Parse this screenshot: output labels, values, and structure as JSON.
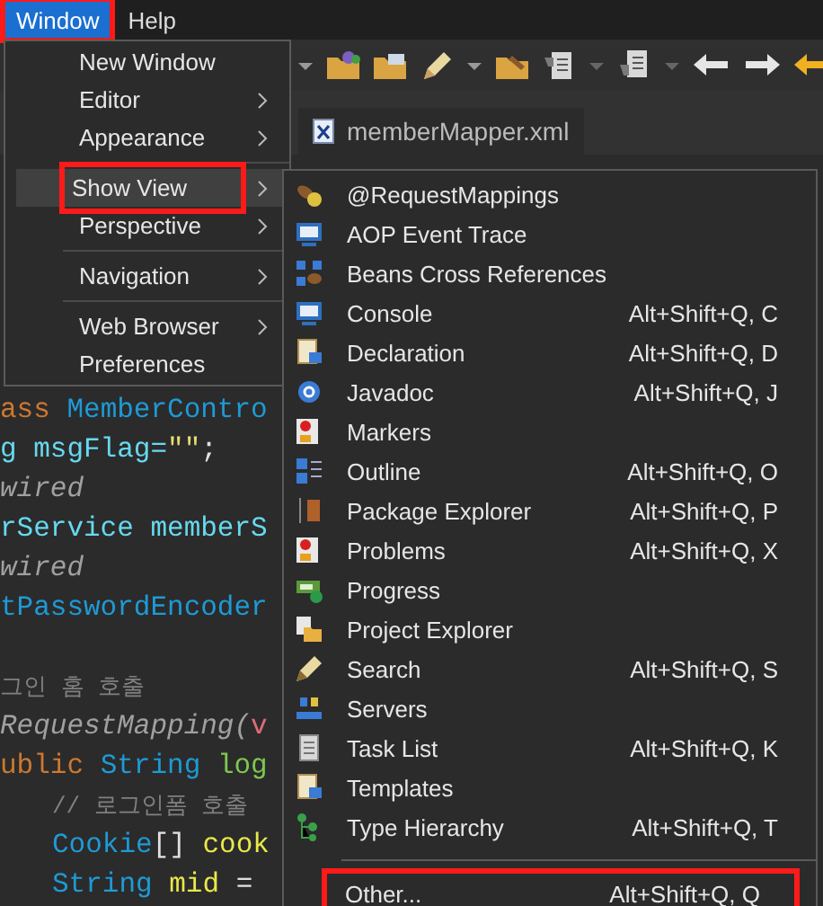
{
  "menubar": [
    {
      "label": "Window",
      "selected": true,
      "annotated": true
    },
    {
      "label": "Help",
      "selected": false,
      "annotated": false
    }
  ],
  "editor_tab": {
    "label": "memberMapper.xml"
  },
  "code_lines": [
    {
      "kind": "code",
      "indented": false,
      "segments": [
        {
          "kind": "keyword",
          "text": "ass "
        },
        {
          "kind": "type",
          "text": "MemberContro"
        }
      ]
    },
    {
      "kind": "code",
      "indented": false,
      "segments": [
        {
          "kind": "field",
          "text": "g msgFlag="
        },
        {
          "kind": "string",
          "text": "\"\""
        },
        {
          "kind": "plain",
          "text": ";"
        }
      ]
    },
    {
      "kind": "code",
      "indented": false,
      "segments": [
        {
          "kind": "annotation",
          "text": "wired"
        }
      ]
    },
    {
      "kind": "code",
      "indented": false,
      "segments": [
        {
          "kind": "field",
          "text": "rService memberS"
        }
      ]
    },
    {
      "kind": "code",
      "indented": false,
      "segments": [
        {
          "kind": "annotation",
          "text": "wired"
        }
      ]
    },
    {
      "kind": "code",
      "indented": false,
      "segments": [
        {
          "kind": "type",
          "text": "tPasswordEncoder"
        }
      ]
    },
    {
      "kind": "blank"
    },
    {
      "kind": "code",
      "indented": false,
      "segments": [
        {
          "kind": "comment",
          "text": "그인 홈 호출"
        }
      ]
    },
    {
      "kind": "code",
      "indented": false,
      "segments": [
        {
          "kind": "annotation",
          "text": "RequestMapping("
        },
        {
          "kind": "param",
          "text": "v"
        }
      ]
    },
    {
      "kind": "code",
      "indented": false,
      "segments": [
        {
          "kind": "keyword",
          "text": "ublic "
        },
        {
          "kind": "type",
          "text": "String "
        },
        {
          "kind": "method",
          "text": "log"
        }
      ]
    },
    {
      "kind": "code",
      "indented": true,
      "segments": [
        {
          "kind": "comment",
          "text": "// 로그인폼 호출"
        }
      ]
    },
    {
      "kind": "code",
      "indented": true,
      "segments": [
        {
          "kind": "type",
          "text": "Cookie"
        },
        {
          "kind": "plain",
          "text": "[] "
        },
        {
          "kind": "variable",
          "text": "cook"
        }
      ]
    },
    {
      "kind": "code",
      "indented": true,
      "segments": [
        {
          "kind": "type",
          "text": "String "
        },
        {
          "kind": "variable",
          "text": "mid"
        },
        {
          "kind": "plain",
          "text": " ="
        }
      ]
    }
  ],
  "window_menu": [
    {
      "kind": "item",
      "label": "New Window",
      "has_submenu": false,
      "selected": false,
      "annotated": false
    },
    {
      "kind": "item",
      "label": "Editor",
      "has_submenu": true,
      "selected": false,
      "annotated": false
    },
    {
      "kind": "item",
      "label": "Appearance",
      "has_submenu": true,
      "selected": false,
      "annotated": false
    },
    {
      "kind": "separator"
    },
    {
      "kind": "item",
      "label": "Show View",
      "has_submenu": true,
      "selected": true,
      "annotated": true
    },
    {
      "kind": "item",
      "label": "Perspective",
      "has_submenu": true,
      "selected": false,
      "annotated": false
    },
    {
      "kind": "separator"
    },
    {
      "kind": "item",
      "label": "Navigation",
      "has_submenu": true,
      "selected": false,
      "annotated": false
    },
    {
      "kind": "separator"
    },
    {
      "kind": "item",
      "label": "Web Browser",
      "has_submenu": true,
      "selected": false,
      "annotated": false
    },
    {
      "kind": "item",
      "label": "Preferences",
      "has_submenu": false,
      "selected": false,
      "annotated": false
    }
  ],
  "show_view_menu": [
    {
      "kind": "item",
      "label": "@RequestMappings",
      "annotated": false
    },
    {
      "kind": "item",
      "label": "AOP Event Trace",
      "annotated": false
    },
    {
      "kind": "item",
      "label": "Beans Cross References",
      "annotated": false
    },
    {
      "kind": "item",
      "label": "Console",
      "shortcut": "Alt+Shift+Q, C",
      "annotated": false
    },
    {
      "kind": "item",
      "label": "Declaration",
      "shortcut": "Alt+Shift+Q, D",
      "annotated": false
    },
    {
      "kind": "item",
      "label": "Javadoc",
      "shortcut": "Alt+Shift+Q, J",
      "annotated": false
    },
    {
      "kind": "item",
      "label": "Markers",
      "annotated": false
    },
    {
      "kind": "item",
      "label": "Outline",
      "shortcut": "Alt+Shift+Q, O",
      "annotated": false
    },
    {
      "kind": "item",
      "label": "Package Explorer",
      "shortcut": "Alt+Shift+Q, P",
      "annotated": false
    },
    {
      "kind": "item",
      "label": "Problems",
      "shortcut": "Alt+Shift+Q, X",
      "annotated": false
    },
    {
      "kind": "item",
      "label": "Progress",
      "annotated": false
    },
    {
      "kind": "item",
      "label": "Project Explorer",
      "annotated": false
    },
    {
      "kind": "item",
      "label": "Search",
      "shortcut": "Alt+Shift+Q, S",
      "annotated": false
    },
    {
      "kind": "item",
      "label": "Servers",
      "annotated": false
    },
    {
      "kind": "item",
      "label": "Task List",
      "shortcut": "Alt+Shift+Q, K",
      "annotated": false
    },
    {
      "kind": "item",
      "label": "Templates",
      "annotated": false
    },
    {
      "kind": "item",
      "label": "Type Hierarchy",
      "shortcut": "Alt+Shift+Q, T",
      "annotated": false
    },
    {
      "kind": "separator"
    },
    {
      "kind": "item",
      "label": "Other...",
      "shortcut": "Alt+Shift+Q, Q",
      "annotated": true
    }
  ]
}
